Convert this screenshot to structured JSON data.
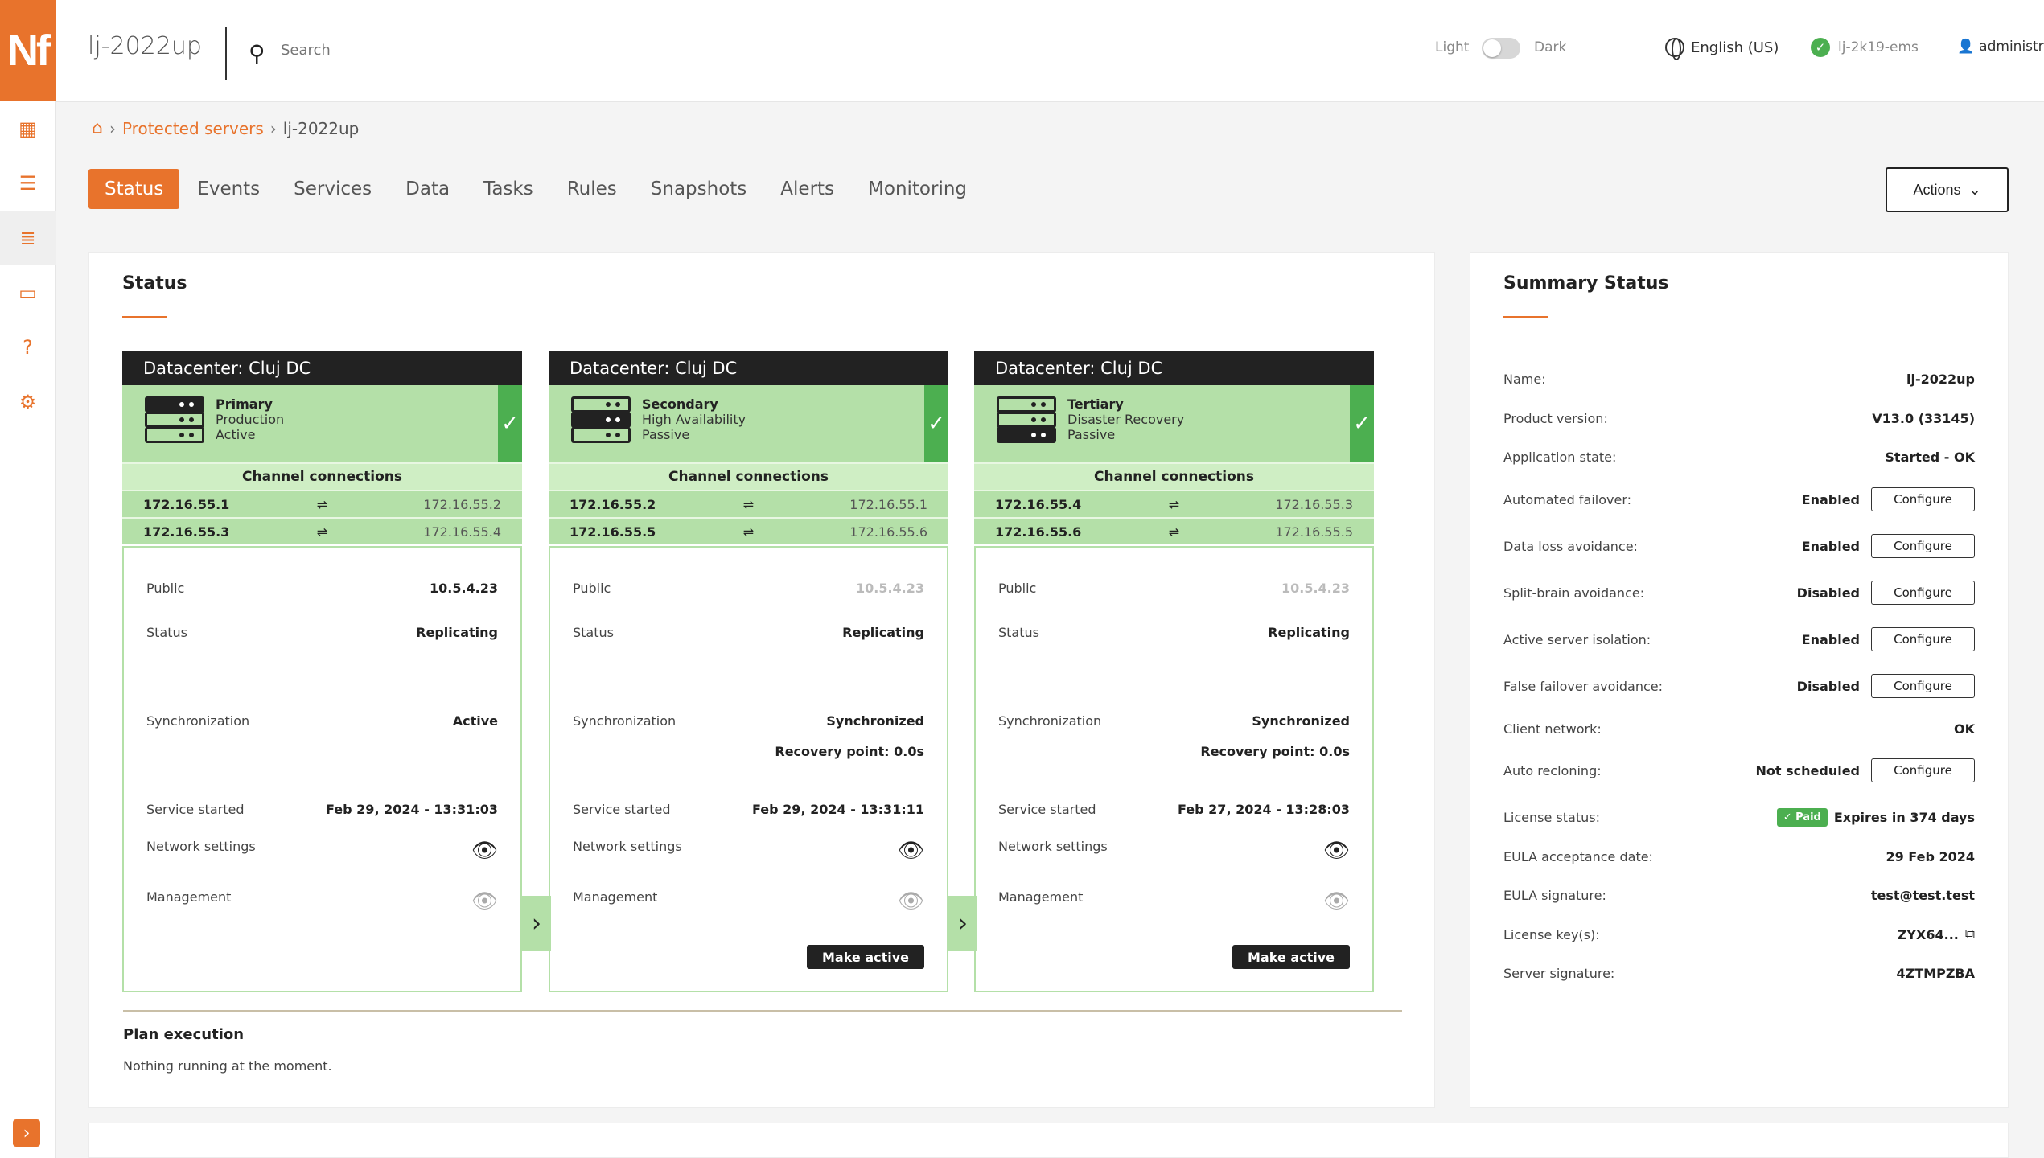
{
  "app": {
    "logo": "Nf",
    "host": "lj-2022up"
  },
  "search": {
    "placeholder": "Search"
  },
  "theme": {
    "light": "Light",
    "dark": "Dark"
  },
  "language": "English (US)",
  "server_status": "lj-2k19-ems",
  "user": "administrator",
  "breadcrumb": {
    "parent": "Protected servers",
    "current": "lj-2022up"
  },
  "tabs": [
    "Status",
    "Events",
    "Services",
    "Data",
    "Tasks",
    "Rules",
    "Snapshots",
    "Alerts",
    "Monitoring"
  ],
  "actions_label": "Actions",
  "status_panel": {
    "title": "Status"
  },
  "datacenters": [
    {
      "header": "Datacenter: Cluj DC",
      "role": [
        "Primary",
        "Production",
        "Active"
      ],
      "channel_title": "Channel connections",
      "channels": [
        [
          "172.16.55.1",
          "172.16.55.2"
        ],
        [
          "172.16.55.3",
          "172.16.55.4"
        ]
      ],
      "public_label": "Public",
      "public": "10.5.4.23",
      "status_label": "Status",
      "status": "Replicating",
      "sync_label": "Synchronization",
      "sync": "Active",
      "recovery": "",
      "started_label": "Service started",
      "started": "Feb 29, 2024 - 13:31:03",
      "network_label": "Network settings",
      "management_label": "Management",
      "make_active": ""
    },
    {
      "header": "Datacenter: Cluj DC",
      "role": [
        "Secondary",
        "High Availability",
        "Passive"
      ],
      "channel_title": "Channel connections",
      "channels": [
        [
          "172.16.55.2",
          "172.16.55.1"
        ],
        [
          "172.16.55.5",
          "172.16.55.6"
        ]
      ],
      "public_label": "Public",
      "public": "10.5.4.23",
      "status_label": "Status",
      "status": "Replicating",
      "sync_label": "Synchronization",
      "sync": "Synchronized",
      "recovery": "Recovery point: 0.0s",
      "started_label": "Service started",
      "started": "Feb 29, 2024 - 13:31:11",
      "network_label": "Network settings",
      "management_label": "Management",
      "make_active": "Make active"
    },
    {
      "header": "Datacenter: Cluj DC",
      "role": [
        "Tertiary",
        "Disaster Recovery",
        "Passive"
      ],
      "channel_title": "Channel connections",
      "channels": [
        [
          "172.16.55.4",
          "172.16.55.3"
        ],
        [
          "172.16.55.6",
          "172.16.55.5"
        ]
      ],
      "public_label": "Public",
      "public": "10.5.4.23",
      "status_label": "Status",
      "status": "Replicating",
      "sync_label": "Synchronization",
      "sync": "Synchronized",
      "recovery": "Recovery point: 0.0s",
      "started_label": "Service started",
      "started": "Feb 27, 2024 - 13:28:03",
      "network_label": "Network settings",
      "management_label": "Management",
      "make_active": "Make active"
    }
  ],
  "plan": {
    "title": "Plan execution",
    "text": "Nothing running at the moment."
  },
  "summary": {
    "title": "Summary Status",
    "configure_label": "Configure",
    "paid_label": "Paid",
    "rows": [
      {
        "label": "Name:",
        "value": "lj-2022up"
      },
      {
        "label": "Product version:",
        "value": "V13.0 (33145)"
      },
      {
        "label": "Application state:",
        "value": "Started - OK"
      },
      {
        "label": "Automated failover:",
        "value": "Enabled"
      },
      {
        "label": "Data loss avoidance:",
        "value": "Enabled"
      },
      {
        "label": "Split-brain avoidance:",
        "value": "Disabled"
      },
      {
        "label": "Active server isolation:",
        "value": "Enabled"
      },
      {
        "label": "False failover avoidance:",
        "value": "Disabled"
      },
      {
        "label": "Client network:",
        "value": "OK"
      },
      {
        "label": "Auto recloning:",
        "value": "Not scheduled"
      },
      {
        "label": "License status:",
        "value": "Expires in 374 days"
      },
      {
        "label": "EULA acceptance date:",
        "value": "29 Feb 2024"
      },
      {
        "label": "EULA signature:",
        "value": "test@test.test"
      },
      {
        "label": "License key(s):",
        "value": "ZYX64..."
      },
      {
        "label": "Server signature:",
        "value": "4ZTMPZBA"
      }
    ]
  },
  "colors": {
    "accent": "#e8732c",
    "green": "#b4e0a8",
    "green_light": "#cfeec4",
    "ok": "#4caf50",
    "dark": "#222222"
  }
}
